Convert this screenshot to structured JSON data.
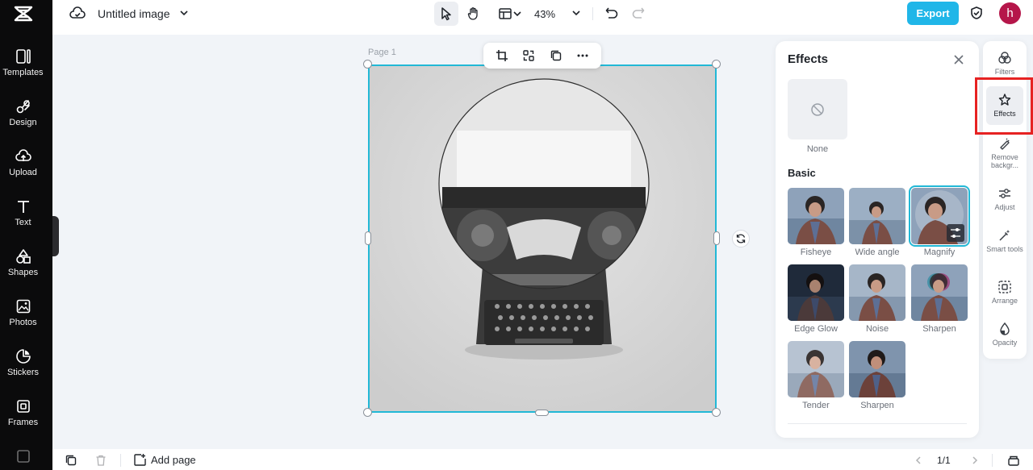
{
  "left_sidebar": {
    "items": [
      {
        "label": "Templates",
        "icon": "templates-icon"
      },
      {
        "label": "Design",
        "icon": "design-icon"
      },
      {
        "label": "Upload",
        "icon": "upload-icon"
      },
      {
        "label": "Text",
        "icon": "text-icon"
      },
      {
        "label": "Shapes",
        "icon": "shapes-icon"
      },
      {
        "label": "Photos",
        "icon": "photos-icon"
      },
      {
        "label": "Stickers",
        "icon": "stickers-icon"
      },
      {
        "label": "Frames",
        "icon": "frames-icon"
      }
    ]
  },
  "topbar": {
    "title": "Untitled image",
    "zoom": "43%",
    "export_label": "Export",
    "avatar_letter": "h"
  },
  "canvas": {
    "page_label": "Page 1"
  },
  "effects_panel": {
    "title": "Effects",
    "none_label": "None",
    "section_title": "Basic",
    "effects": [
      {
        "label": "Fisheye"
      },
      {
        "label": "Wide angle"
      },
      {
        "label": "Magnify",
        "selected": true
      },
      {
        "label": "Edge Glow"
      },
      {
        "label": "Noise"
      },
      {
        "label": "Sharpen"
      },
      {
        "label": "Tender"
      },
      {
        "label": "Sharpen"
      }
    ]
  },
  "right_toolbar": {
    "items": [
      {
        "label": "Filters",
        "icon": "filters-icon"
      },
      {
        "label": "Effects",
        "icon": "effects-icon",
        "active": true
      },
      {
        "label": "Remove backgr...",
        "icon": "remove-background-icon"
      },
      {
        "label": "Adjust",
        "icon": "adjust-icon"
      },
      {
        "label": "Smart tools",
        "icon": "smart-tools-icon"
      },
      {
        "label": "Arrange",
        "icon": "arrange-icon"
      },
      {
        "label": "Opacity",
        "icon": "opacity-icon"
      }
    ]
  },
  "bottombar": {
    "add_page_label": "Add page",
    "page_counter": "1/1"
  },
  "colors": {
    "accent": "#20b6e8",
    "selection": "#22b8d6",
    "sidebar_bg": "#0b0b0c",
    "avatar_bg": "#b5164a",
    "highlight": "#e62222"
  }
}
